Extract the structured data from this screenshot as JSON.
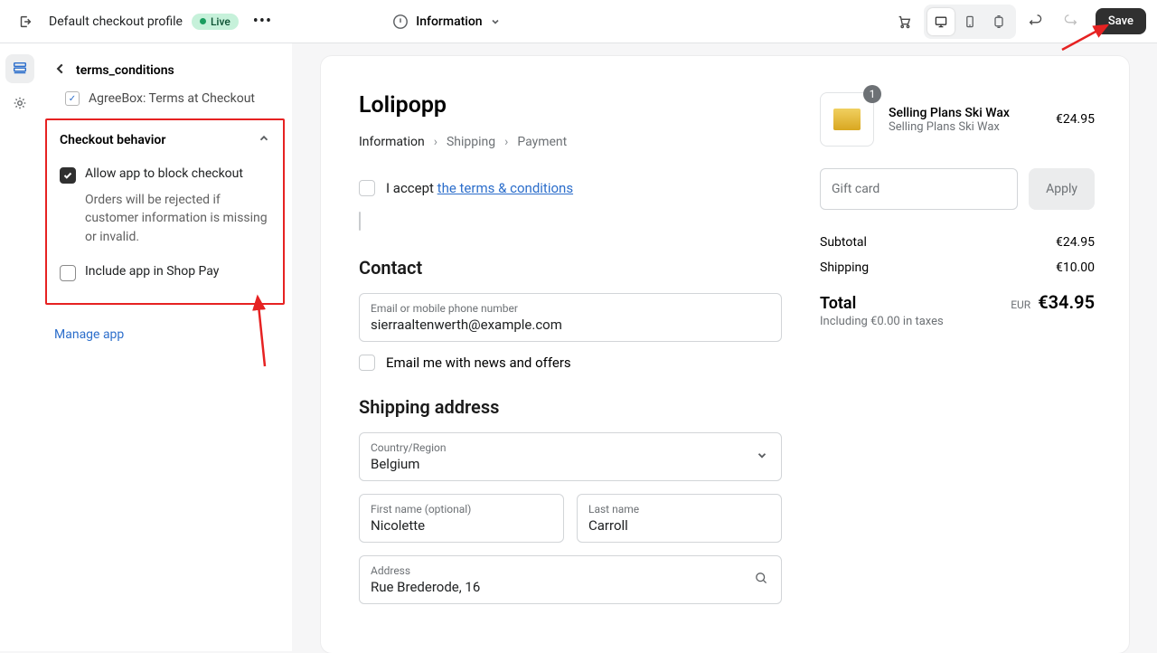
{
  "topbar": {
    "profile_name": "Default checkout profile",
    "live_label": "Live",
    "center_label": "Information",
    "save_label": "Save"
  },
  "sidebar": {
    "crumb": "terms_conditions",
    "app_name": "AgreeBox: Terms at Checkout",
    "panel_title": "Checkout behavior",
    "opt1_label": "Allow app to block checkout",
    "opt1_desc": "Orders will be rejected if customer information is missing or invalid.",
    "opt2_label": "Include app in Shop Pay",
    "manage_label": "Manage app"
  },
  "checkout": {
    "store": "Lolipopp",
    "steps": {
      "info": "Information",
      "ship": "Shipping",
      "pay": "Payment"
    },
    "accept_prefix": "I accept ",
    "accept_link": "the terms & conditions",
    "contact_title": "Contact",
    "email_label": "Email or mobile phone number",
    "email_value": "sierraaltenwerth@example.com",
    "news_label": "Email me with news and offers",
    "ship_title": "Shipping address",
    "country_label": "Country/Region",
    "country_value": "Belgium",
    "fname_label": "First name (optional)",
    "fname_value": "Nicolette",
    "lname_label": "Last name",
    "lname_value": "Carroll",
    "addr_label": "Address",
    "addr_value": "Rue Brederode, 16"
  },
  "summary": {
    "item_name": "Selling Plans Ski Wax",
    "item_sub": "Selling Plans Ski Wax",
    "item_qty": "1",
    "item_price": "€24.95",
    "gift_placeholder": "Gift card",
    "apply_label": "Apply",
    "subtotal_label": "Subtotal",
    "subtotal_value": "€24.95",
    "shipping_label": "Shipping",
    "shipping_value": "€10.00",
    "total_label": "Total",
    "total_currency": "EUR",
    "total_value": "€34.95",
    "tax_note": "Including €0.00 in taxes"
  }
}
